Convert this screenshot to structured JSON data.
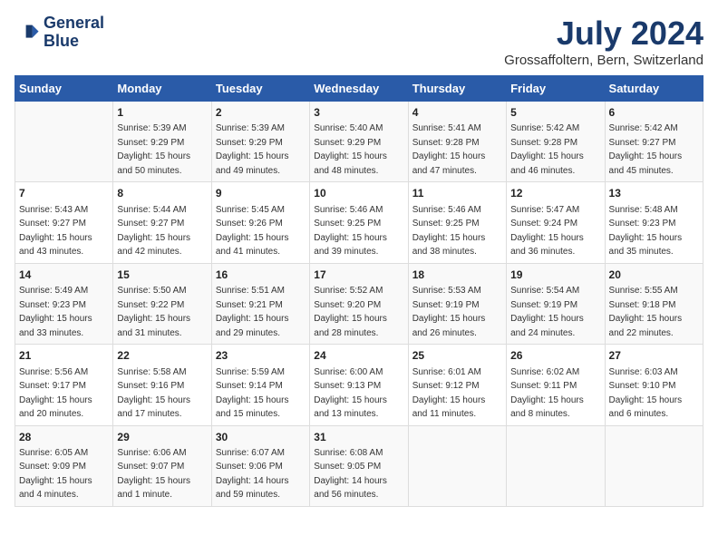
{
  "logo": {
    "line1": "General",
    "line2": "Blue"
  },
  "title": "July 2024",
  "subtitle": "Grossaffoltern, Bern, Switzerland",
  "days": [
    "Sunday",
    "Monday",
    "Tuesday",
    "Wednesday",
    "Thursday",
    "Friday",
    "Saturday"
  ],
  "weeks": [
    [
      {
        "day": "",
        "content": ""
      },
      {
        "day": "1",
        "content": "Sunrise: 5:39 AM\nSunset: 9:29 PM\nDaylight: 15 hours\nand 50 minutes."
      },
      {
        "day": "2",
        "content": "Sunrise: 5:39 AM\nSunset: 9:29 PM\nDaylight: 15 hours\nand 49 minutes."
      },
      {
        "day": "3",
        "content": "Sunrise: 5:40 AM\nSunset: 9:29 PM\nDaylight: 15 hours\nand 48 minutes."
      },
      {
        "day": "4",
        "content": "Sunrise: 5:41 AM\nSunset: 9:28 PM\nDaylight: 15 hours\nand 47 minutes."
      },
      {
        "day": "5",
        "content": "Sunrise: 5:42 AM\nSunset: 9:28 PM\nDaylight: 15 hours\nand 46 minutes."
      },
      {
        "day": "6",
        "content": "Sunrise: 5:42 AM\nSunset: 9:27 PM\nDaylight: 15 hours\nand 45 minutes."
      }
    ],
    [
      {
        "day": "7",
        "content": "Sunrise: 5:43 AM\nSunset: 9:27 PM\nDaylight: 15 hours\nand 43 minutes."
      },
      {
        "day": "8",
        "content": "Sunrise: 5:44 AM\nSunset: 9:27 PM\nDaylight: 15 hours\nand 42 minutes."
      },
      {
        "day": "9",
        "content": "Sunrise: 5:45 AM\nSunset: 9:26 PM\nDaylight: 15 hours\nand 41 minutes."
      },
      {
        "day": "10",
        "content": "Sunrise: 5:46 AM\nSunset: 9:25 PM\nDaylight: 15 hours\nand 39 minutes."
      },
      {
        "day": "11",
        "content": "Sunrise: 5:46 AM\nSunset: 9:25 PM\nDaylight: 15 hours\nand 38 minutes."
      },
      {
        "day": "12",
        "content": "Sunrise: 5:47 AM\nSunset: 9:24 PM\nDaylight: 15 hours\nand 36 minutes."
      },
      {
        "day": "13",
        "content": "Sunrise: 5:48 AM\nSunset: 9:23 PM\nDaylight: 15 hours\nand 35 minutes."
      }
    ],
    [
      {
        "day": "14",
        "content": "Sunrise: 5:49 AM\nSunset: 9:23 PM\nDaylight: 15 hours\nand 33 minutes."
      },
      {
        "day": "15",
        "content": "Sunrise: 5:50 AM\nSunset: 9:22 PM\nDaylight: 15 hours\nand 31 minutes."
      },
      {
        "day": "16",
        "content": "Sunrise: 5:51 AM\nSunset: 9:21 PM\nDaylight: 15 hours\nand 29 minutes."
      },
      {
        "day": "17",
        "content": "Sunrise: 5:52 AM\nSunset: 9:20 PM\nDaylight: 15 hours\nand 28 minutes."
      },
      {
        "day": "18",
        "content": "Sunrise: 5:53 AM\nSunset: 9:19 PM\nDaylight: 15 hours\nand 26 minutes."
      },
      {
        "day": "19",
        "content": "Sunrise: 5:54 AM\nSunset: 9:19 PM\nDaylight: 15 hours\nand 24 minutes."
      },
      {
        "day": "20",
        "content": "Sunrise: 5:55 AM\nSunset: 9:18 PM\nDaylight: 15 hours\nand 22 minutes."
      }
    ],
    [
      {
        "day": "21",
        "content": "Sunrise: 5:56 AM\nSunset: 9:17 PM\nDaylight: 15 hours\nand 20 minutes."
      },
      {
        "day": "22",
        "content": "Sunrise: 5:58 AM\nSunset: 9:16 PM\nDaylight: 15 hours\nand 17 minutes."
      },
      {
        "day": "23",
        "content": "Sunrise: 5:59 AM\nSunset: 9:14 PM\nDaylight: 15 hours\nand 15 minutes."
      },
      {
        "day": "24",
        "content": "Sunrise: 6:00 AM\nSunset: 9:13 PM\nDaylight: 15 hours\nand 13 minutes."
      },
      {
        "day": "25",
        "content": "Sunrise: 6:01 AM\nSunset: 9:12 PM\nDaylight: 15 hours\nand 11 minutes."
      },
      {
        "day": "26",
        "content": "Sunrise: 6:02 AM\nSunset: 9:11 PM\nDaylight: 15 hours\nand 8 minutes."
      },
      {
        "day": "27",
        "content": "Sunrise: 6:03 AM\nSunset: 9:10 PM\nDaylight: 15 hours\nand 6 minutes."
      }
    ],
    [
      {
        "day": "28",
        "content": "Sunrise: 6:05 AM\nSunset: 9:09 PM\nDaylight: 15 hours\nand 4 minutes."
      },
      {
        "day": "29",
        "content": "Sunrise: 6:06 AM\nSunset: 9:07 PM\nDaylight: 15 hours\nand 1 minute."
      },
      {
        "day": "30",
        "content": "Sunrise: 6:07 AM\nSunset: 9:06 PM\nDaylight: 14 hours\nand 59 minutes."
      },
      {
        "day": "31",
        "content": "Sunrise: 6:08 AM\nSunset: 9:05 PM\nDaylight: 14 hours\nand 56 minutes."
      },
      {
        "day": "",
        "content": ""
      },
      {
        "day": "",
        "content": ""
      },
      {
        "day": "",
        "content": ""
      }
    ]
  ]
}
